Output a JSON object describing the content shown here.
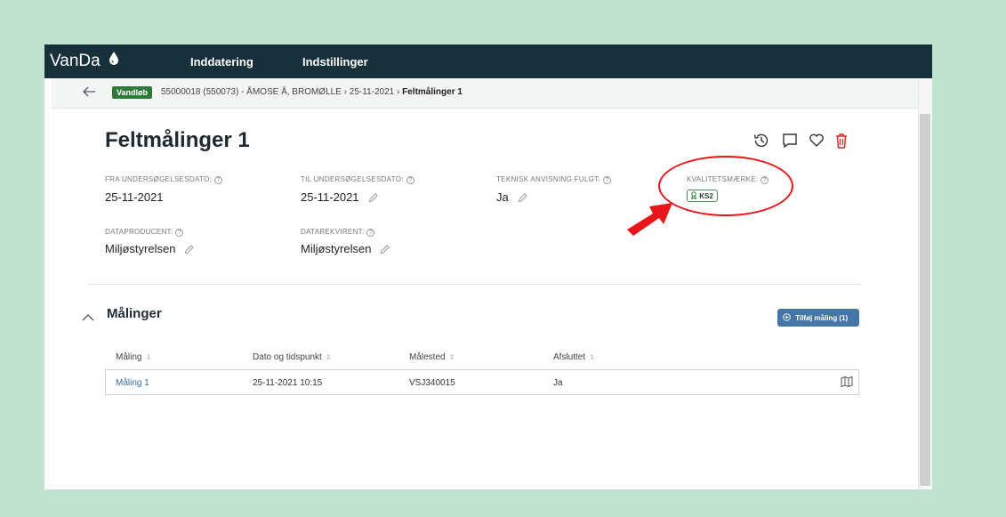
{
  "app": {
    "name": "VanDa",
    "nav": [
      "Inddatering",
      "Indstillinger"
    ]
  },
  "breadcrumb": {
    "badge": "Vandløb",
    "path": "55000018 (550073) - ÅMOSE Å, BROMØLLE",
    "date": "25-11-2021",
    "current": "Feltmålinger 1",
    "separator": "›"
  },
  "page": {
    "title": "Feltmålinger 1",
    "help_symbol": "?"
  },
  "fields": {
    "fra_label": "FRA UNDERSØGELSESDATO:",
    "fra_value": "25-11-2021",
    "til_label": "TIL UNDERSØGELSESDATO:",
    "til_value": "25-11-2021",
    "teknisk_label": "TEKNISK ANVISNING FULGT:",
    "teknisk_value": "Ja",
    "kvalitet_label": "KVALITETSMÆRKE:",
    "kvalitet_value": "KS2",
    "producent_label": "DATAPRODUCENT:",
    "producent_value": "Miljøstyrelsen",
    "rekvirent_label": "DATAREKVIRENT:",
    "rekvirent_value": "Miljøstyrelsen"
  },
  "section": {
    "title": "Målinger",
    "add_label": "Tilføj måling (1)"
  },
  "table": {
    "columns": [
      "Måling",
      "Dato og tidspunkt",
      "Målested",
      "Afsluttet"
    ],
    "rows": [
      {
        "maaling": "Måling 1",
        "dato": "25-11-2021 10:15",
        "maalested": "VSJ340015",
        "afsluttet": "Ja"
      }
    ]
  },
  "colors": {
    "appbar": "#17303a",
    "badge_green": "#2f7a3a",
    "button_blue": "#4676a8",
    "annotation_red": "#e8151b",
    "page_bg": "#c2e3d2"
  },
  "icons": {
    "history": "history-icon",
    "comment": "comment-icon",
    "favorite": "heart-icon",
    "delete": "trash-icon",
    "map": "map-icon"
  }
}
